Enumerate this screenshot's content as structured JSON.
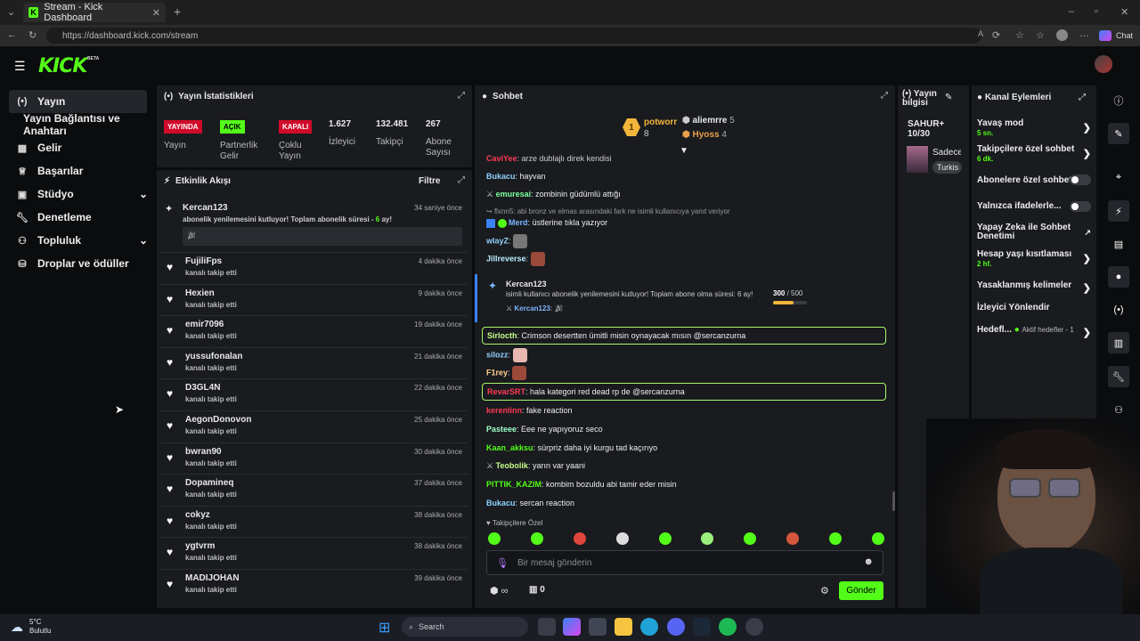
{
  "browser": {
    "tab_title": "Stream - Kick Dashboard",
    "url": "https://dashboard.kick.com/stream",
    "chat_label": "Chat"
  },
  "header": {
    "logo": "KICK",
    "beta": "BETA"
  },
  "sidebar": {
    "items": [
      {
        "label": "Yayın",
        "icon": "broadcast-icon"
      },
      {
        "label": "Yayın Bağlantısı ve Anahtarı",
        "icon": ""
      },
      {
        "label": "Gelir",
        "icon": "revenue-icon"
      },
      {
        "label": "Başarılar",
        "icon": "trophy-icon"
      },
      {
        "label": "Stüdyo",
        "icon": "studio-icon"
      },
      {
        "label": "Denetleme",
        "icon": "wrench-icon"
      },
      {
        "label": "Topluluk",
        "icon": "community-icon"
      },
      {
        "label": "Droplar ve ödüller",
        "icon": "drops-icon"
      }
    ]
  },
  "stats": {
    "title": "Yayın İstatistikleri",
    "items": [
      {
        "badge": "YAYINDA",
        "label": "Yayın",
        "color": "#d10a2a"
      },
      {
        "badge": "AÇIK",
        "label": "Partnerlik Gelir",
        "color": "#53fc18"
      },
      {
        "badge": "KAPALI",
        "label": "Çoklu Yayın",
        "color": "#d10a2a"
      },
      {
        "value": "1.627",
        "label": "İzleyici"
      },
      {
        "value": "132.481",
        "label": "Takipçi"
      },
      {
        "value": "267",
        "label": "Abone Sayısı"
      }
    ]
  },
  "activity": {
    "title": "Etkinlik Akışı",
    "filter": "Filtre",
    "highlight": {
      "name": "Kercan123",
      "text": "abonelik yenilemesini kutluyor! Toplam abonelik süresi - ",
      "months": "6",
      "suffix": " ay!",
      "time": "34 saniye önce"
    },
    "rows": [
      {
        "name": "FujiliFps",
        "sub": "kanalı takip etti",
        "time": "4 dakika önce"
      },
      {
        "name": "Hexien",
        "sub": "kanalı takip etti",
        "time": "9 dakika önce"
      },
      {
        "name": "emir7096",
        "sub": "kanalı takip etti",
        "time": "19 dakika önce"
      },
      {
        "name": "yussufonalan",
        "sub": "kanalı takip etti",
        "time": "21 dakika önce"
      },
      {
        "name": "D3GL4N",
        "sub": "kanalı takip etti",
        "time": "22 dakika önce"
      },
      {
        "name": "AegonDonovon",
        "sub": "kanalı takip etti",
        "time": "25 dakika önce"
      },
      {
        "name": "bwran90",
        "sub": "kanalı takip etti",
        "time": "30 dakika önce"
      },
      {
        "name": "Dopamineq",
        "sub": "kanalı takip etti",
        "time": "37 dakika önce"
      },
      {
        "name": "cokyz",
        "sub": "kanalı takip etti",
        "time": "38 dakika önce"
      },
      {
        "name": "ygtvrm",
        "sub": "kanalı takip etti",
        "time": "38 dakika önce"
      },
      {
        "name": "MADIJOHAN",
        "sub": "kanalı takip etti",
        "time": "39 dakika önce"
      }
    ]
  },
  "chat": {
    "title": "Sohbet",
    "leaders": [
      {
        "rank": "1",
        "name": "potworr",
        "count": "8"
      },
      {
        "name": "aliemrre",
        "count": "5"
      },
      {
        "name": "Hyoss",
        "count": "4"
      }
    ],
    "messages": [
      {
        "user": "Bukacu",
        "color": "#8fd1ff",
        "text": "hayvan"
      },
      {
        "user": "emuresai",
        "color": "#7cff9a",
        "text": "zombinin güdümlü attığı"
      },
      {
        "reply": "flxnn5: abi bronz ve elmas arasındaki fark ne isimli kullanıcıya yanıt veriyor"
      },
      {
        "user": "Merd",
        "color": "#7cb5ff",
        "text": "üstlerine tıkla yazıyor"
      },
      {
        "user": "wlayZ",
        "color": "#8fd1ff",
        "text": ""
      },
      {
        "user": "Jillreverse",
        "color": "#b9f0ff",
        "text": ""
      },
      {
        "user": "Sirlocth",
        "color": "#c8ff8a",
        "text": "Crimson desertten ümitli misin oynayacak mısın @sercanzurna"
      },
      {
        "user": "silozz",
        "color": "#8fd1ff",
        "text": ""
      },
      {
        "user": "F1rey",
        "color": "#ffd18a",
        "text": ""
      },
      {
        "user": "RevarSRT",
        "color": "#ff3b56",
        "text": "hala kategori red dead rp de @sercanzurna"
      },
      {
        "user": "kerenlinn",
        "color": "#ff3b56",
        "text": "fake reaction"
      },
      {
        "user": "Pasteee",
        "color": "#9effc8",
        "text": "Eee ne yapıyoruz seco"
      },
      {
        "user": "Kaan_akksu",
        "color": "#53fc18",
        "text": "sürpriz daha iyi kurgu tad kaçırıyo"
      },
      {
        "user": "Teobolik",
        "color": "#c8ff8a",
        "text": "yarın var yaani"
      },
      {
        "user": "PITTIK_KAZIM",
        "color": "#53fc18",
        "text": "kombim bozuldu abi tamir eder misin"
      },
      {
        "user": "Bukacu",
        "color": "#8fd1ff",
        "text": "sercan reaction"
      }
    ],
    "sub_event": {
      "name": "Kercan123",
      "text": "isimli kullanıcı abonelik yenilemesini kutluyor! Toplam abone olma süresi: 6 ay!",
      "progress": "300",
      "goal": "500",
      "progress_fraction": 0.6,
      "reply_user": "Kercan123"
    },
    "followers_only": "Takipçilere Özel",
    "placeholder": "Bir mesaj gönderin",
    "send": "Gönder",
    "count_zero": "0"
  },
  "stream_info": {
    "title": "Yayın bilgisi",
    "name": "SAHUR+",
    "progress": "10/30",
    "stream_title": "Sadece",
    "tag": "Turkis"
  },
  "channel_actions": {
    "title": "Kanal Eylemleri",
    "items": [
      {
        "label": "Yavaş mod",
        "sub": "5 sn."
      },
      {
        "label": "Takipçilere özel sohbet",
        "sub": "6 dk."
      },
      {
        "label": "Abonelere özel sohbet"
      },
      {
        "label": "Yalnızca ifadelerle..."
      },
      {
        "label": "Yapay Zeka ile Sohbet Denetimi"
      },
      {
        "label": "Hesap yaşı kısıtlaması",
        "sub": "2 hf."
      },
      {
        "label": "Yasaklanmış kelimeler"
      },
      {
        "label": "İzleyici Yönlendir"
      },
      {
        "label": "Hedefl...",
        "sub": "Aktif hedefler - 1"
      }
    ]
  },
  "taskbar": {
    "temp": "5°C",
    "weather": "Bulutlu",
    "search": "Search"
  }
}
